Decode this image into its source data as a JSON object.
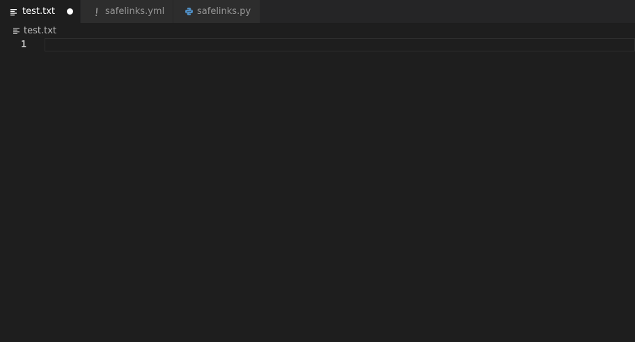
{
  "tabs": [
    {
      "label": "test.txt",
      "icon": "text-file-icon",
      "active": true,
      "modified": true
    },
    {
      "label": "safelinks.yml",
      "icon": "yaml-exclamation-icon",
      "active": false,
      "modified": false
    },
    {
      "label": "safelinks.py",
      "icon": "python-icon",
      "active": false,
      "modified": false
    }
  ],
  "breadcrumb": {
    "label": "test.txt",
    "icon": "text-file-icon"
  },
  "editor": {
    "line_numbers": [
      "1"
    ],
    "lines": [
      ""
    ]
  },
  "colors": {
    "editor_bg": "#1e1e1e",
    "tabbar_bg": "#252526",
    "inactive_tab_bg": "#2d2d2d",
    "python_icon": "#4f8ec4",
    "yaml_icon": "#a0a0a0"
  }
}
